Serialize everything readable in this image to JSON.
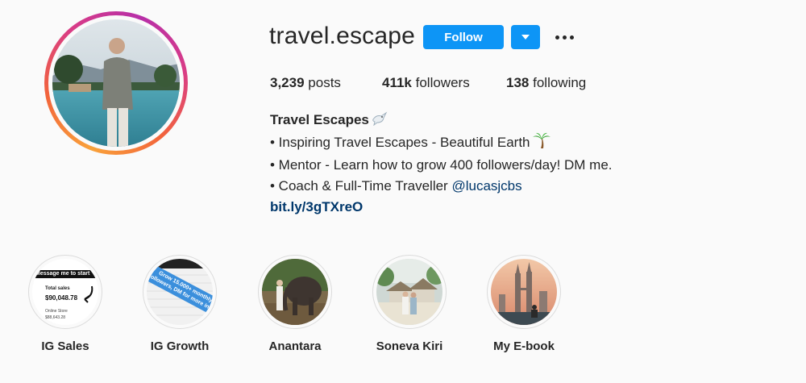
{
  "profile": {
    "username": "travel.escape",
    "follow_label": "Follow",
    "stats": {
      "posts_count": "3,239",
      "posts_label": "posts",
      "followers_count": "411k",
      "followers_label": "followers",
      "following_count": "138",
      "following_label": "following"
    },
    "bio": {
      "name": "Travel Escapes",
      "name_emoji": "dove-icon",
      "line1": "• Inspiring Travel Escapes - Beautiful Earth",
      "line1_emoji": "palm-tree-icon",
      "line2": "• Mentor - Learn how to grow 400 followers/day! DM me.",
      "line3": "• Coach & Full-Time Traveller",
      "mention": "@lucasjcbs",
      "link": "bit.ly/3gTXreO"
    }
  },
  "highlights": [
    {
      "label": "IG Sales",
      "thumb_text": {
        "banner": "Message me to start",
        "title": "Total sales",
        "amount": "$90,048.78",
        "sub": "Online Store",
        "sub_amount": "$88,643.28"
      }
    },
    {
      "label": "IG Growth",
      "thumb_text": {
        "overlay": "Grow 15.000+ monthly followers, DM for more info!"
      }
    },
    {
      "label": "Anantara"
    },
    {
      "label": "Soneva Kiri"
    },
    {
      "label": "My E-book"
    }
  ],
  "colors": {
    "accent": "#0d95f6",
    "link": "#00376b",
    "text": "#262626",
    "background": "#fafafa"
  }
}
